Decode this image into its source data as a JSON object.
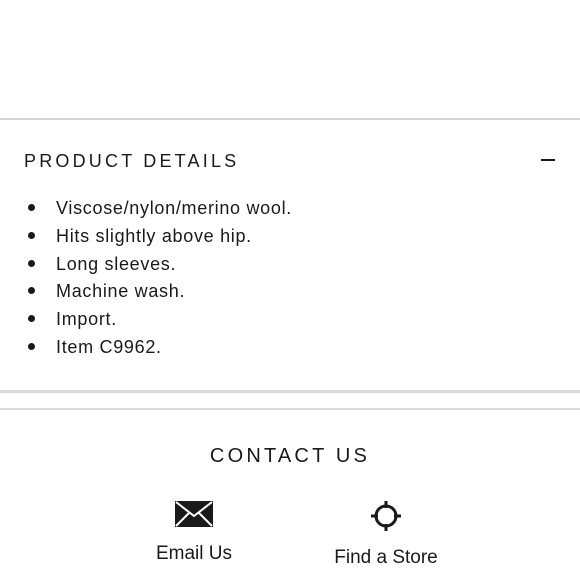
{
  "product_details": {
    "title": "PRODUCT DETAILS",
    "collapse_icon": "minus-icon",
    "items": [
      "Viscose/nylon/merino wool.",
      "Hits slightly above hip.",
      "Long sleeves.",
      "Machine wash.",
      "Import.",
      "Item C9962."
    ]
  },
  "contact": {
    "title": "CONTACT US",
    "email": {
      "label": "Email Us",
      "icon": "envelope-icon"
    },
    "store": {
      "label": "Find a Store",
      "icon": "crosshair-icon"
    }
  }
}
